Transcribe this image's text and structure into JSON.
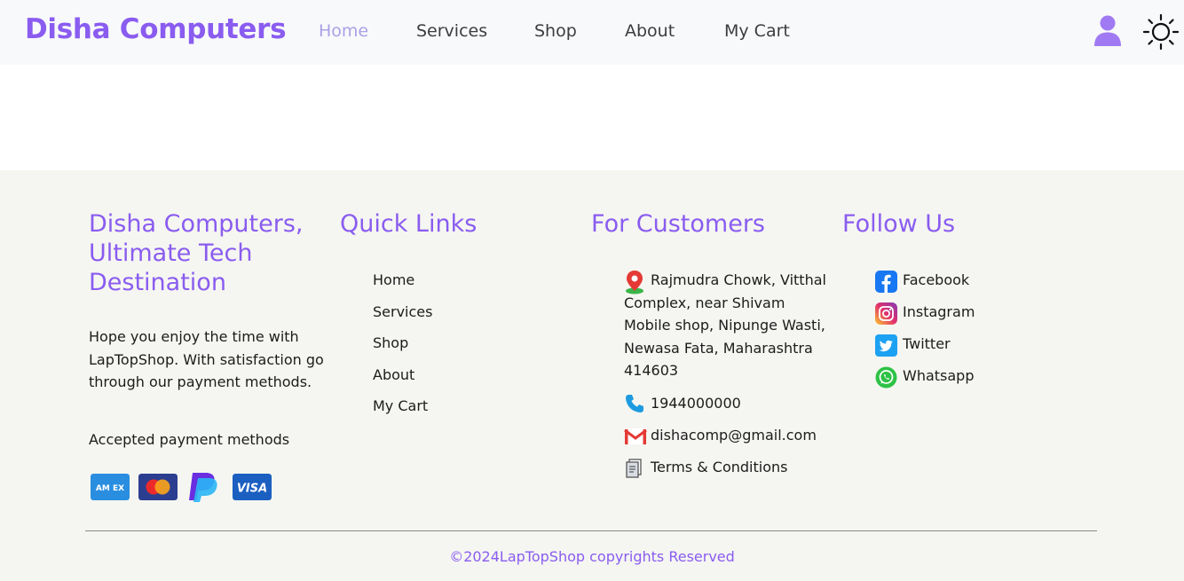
{
  "navbar": {
    "brand": "Disha Computers",
    "links": [
      "Home",
      "Services",
      "Shop",
      "About",
      "My Cart"
    ],
    "active_link": "Home",
    "brand_color": "#8a5cf0",
    "user_icon": "user-icon",
    "theme_icon": "sun-icon"
  },
  "footer": {
    "about": {
      "title": "Disha Computers, Ultimate Tech Destination",
      "text": "Hope you enjoy the time with LapTopShop. With satisfaction go through our payment methods.",
      "payment_title": "Accepted payment methods",
      "payment_icons": [
        "amex-icon",
        "mastercard-icon",
        "paypal-icon",
        "visa-icon"
      ],
      "amex_label": "AM EX",
      "visa_label": "VISA"
    },
    "quick_links": {
      "title": "Quick Links",
      "items": [
        "Home",
        "Services",
        "Shop",
        "About",
        "My Cart"
      ]
    },
    "customers": {
      "title": "For Customers",
      "address": "Rajmudra Chowk, Vitthal Complex, near Shivam Mobile shop, Nipunge Wasti, Newasa Fata, Maharashtra 414603",
      "phone": "1944000000",
      "email": "dishacomp@gmail.com",
      "terms": "Terms & Conditions"
    },
    "follow": {
      "title": "Follow Us",
      "items": [
        "Facebook",
        "Instagram",
        "Twitter",
        "Whatsapp"
      ]
    },
    "copyright": "©2024LapTopShop copyrights Reserved"
  }
}
